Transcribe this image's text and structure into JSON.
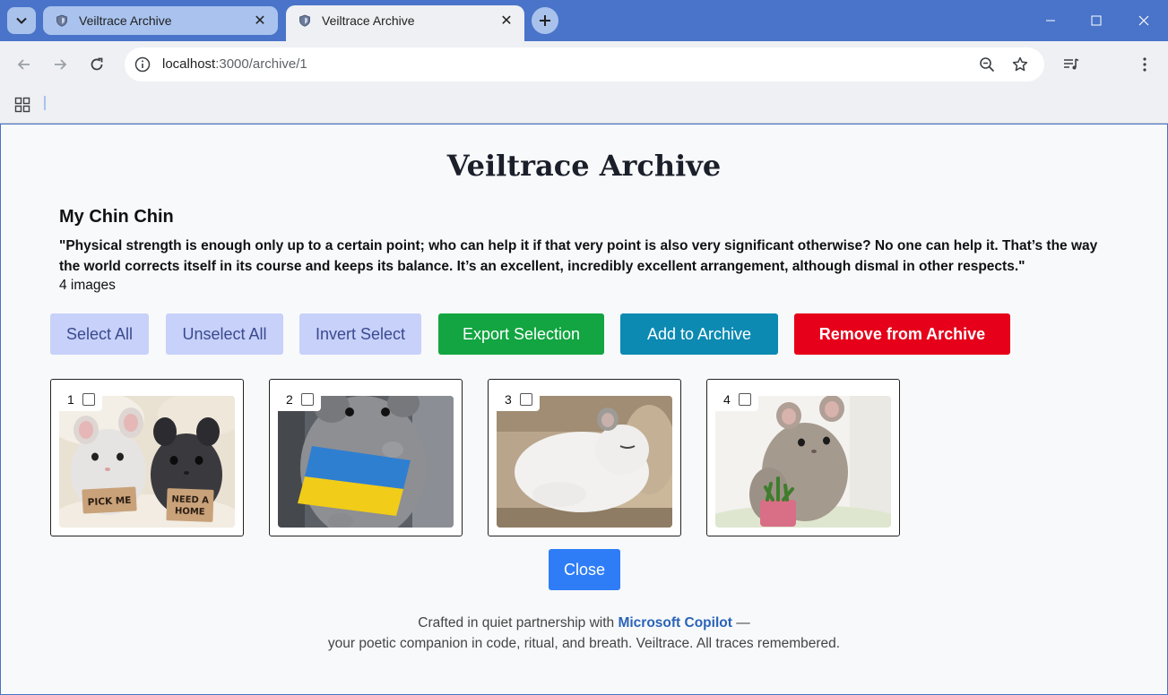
{
  "browser": {
    "tabs": [
      {
        "title": "Veiltrace Archive",
        "active": false
      },
      {
        "title": "Veiltrace Archive",
        "active": true
      }
    ],
    "url_host": "localhost",
    "url_path": ":3000/archive/1"
  },
  "page": {
    "title": "Veiltrace Archive",
    "album_name": "My Chin Chin",
    "quote": "\"Physical strength is enough only up to a certain point; who can help it if that very point is also very significant otherwise? No one can help it. That’s the way the world corrects itself in its course and keeps its balance. It’s an excellent, incredibly excellent arrangement, although dismal in other respects.\"",
    "image_count": "4 images"
  },
  "actions": {
    "select_all": "Select All",
    "unselect_all": "Unselect All",
    "invert_select": "Invert Select",
    "export_selection": "Export Selection",
    "add_to_archive": "Add to Archive",
    "remove_from_archive": "Remove from Archive"
  },
  "images": [
    {
      "index": "1",
      "checked": false,
      "sign_left": "PICK ME",
      "sign_right_1": "NEED A",
      "sign_right_2": "HOME"
    },
    {
      "index": "2",
      "checked": false
    },
    {
      "index": "3",
      "checked": false
    },
    {
      "index": "4",
      "checked": false
    }
  ],
  "close_label": "Close",
  "footer": {
    "prefix": "Crafted in quiet partnership with ",
    "link": "Microsoft Copilot",
    "suffix": " —",
    "line2": "your poetic companion in code, ritual, and breath. Veiltrace. All traces remembered."
  },
  "colors": {
    "export": "#12a541",
    "add": "#0c8ab2",
    "remove": "#e6001a",
    "close": "#2f7df6",
    "select_buttons": "#c7d1f9"
  }
}
